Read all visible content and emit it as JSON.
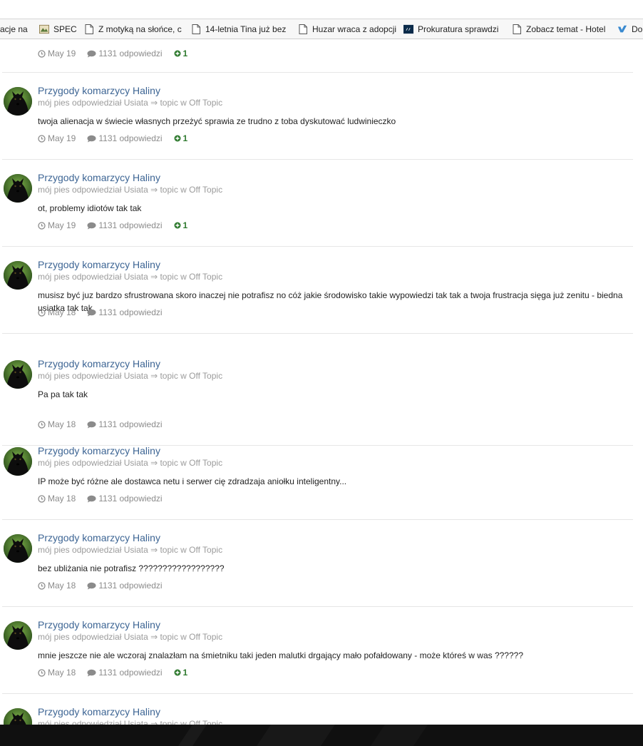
{
  "bookmarks": [
    {
      "label": "acje na",
      "icon": "page-icon"
    },
    {
      "label": "SPEC",
      "icon": "spec-favicon"
    },
    {
      "label": "Z motyką na słońce, c",
      "icon": "page-icon"
    },
    {
      "label": "14-letnia Tina już bez",
      "icon": "page-icon"
    },
    {
      "label": "Huzar wraca z adopcji",
      "icon": "page-icon"
    },
    {
      "label": "Prokuratura sprawdzi",
      "icon": "news-favicon"
    },
    {
      "label": "Zobacz temat - Hotel",
      "icon": "page-icon"
    },
    {
      "label": "Do",
      "icon": "checkmark-favicon"
    }
  ],
  "top_stats": {
    "date": "May 19",
    "replies": "1131 odpowiedzi",
    "rep": "1"
  },
  "posts": [
    {
      "title": "Przygody komarzycy Haliny",
      "meta": "mój pies odpowiedział Usiata ⇒ topic w Off Topic",
      "body": "twoja alienacja w świecie własnych przeżyć sprawia ze trudno z toba dyskutować ludwinieczko",
      "date": "May 19",
      "replies": "1131 odpowiedzi",
      "rep": "1"
    },
    {
      "title": "Przygody komarzycy Haliny",
      "meta": "mój pies odpowiedział Usiata ⇒ topic w Off Topic",
      "body": "ot, problemy idiotów tak tak",
      "date": "May 19",
      "replies": "1131 odpowiedzi",
      "rep": "1"
    },
    {
      "title": "Przygody komarzycy Haliny",
      "meta": "mój pies odpowiedział Usiata ⇒ topic w Off Topic",
      "body": "musisz być juz bardzo sfrustrowana skoro inaczej nie potrafisz no cóż jakie środowisko takie wypowiedzi tak tak a twoja frustracja sięga już zenitu - biedna usiatka tak tak",
      "date": "May 18",
      "replies": "1131 odpowiedzi",
      "rep": ""
    },
    {
      "title": "Przygody komarzycy Haliny",
      "meta": "mój pies odpowiedział Usiata ⇒ topic w Off Topic",
      "body": "Pa pa tak tak",
      "date": "May 18",
      "replies": "1131 odpowiedzi",
      "rep": ""
    },
    {
      "title": "Przygody komarzycy Haliny",
      "meta": "mój pies odpowiedział Usiata ⇒ topic w Off Topic",
      "body": "IP może być różne ale dostawca netu i serwer cię zdradzaja aniołku inteligentny...",
      "date": "May 18",
      "replies": "1131 odpowiedzi",
      "rep": ""
    },
    {
      "title": "Przygody komarzycy Haliny",
      "meta": "mój pies odpowiedział Usiata ⇒ topic w Off Topic",
      "body": "bez ubliżania nie potrafisz ??????????????????",
      "date": "May 18",
      "replies": "1131 odpowiedzi",
      "rep": ""
    },
    {
      "title": "Przygody komarzycy Haliny",
      "meta": "mój pies odpowiedział Usiata ⇒ topic w Off Topic",
      "body": "mnie jeszcze nie ale wczoraj znalazłam na śmietniku taki jeden malutki drgający mało pofałdowany - może któreś w was ??????",
      "date": "May 18",
      "replies": "1131 odpowiedzi",
      "rep": "1"
    },
    {
      "title": "Przygody komarzycy Haliny",
      "meta": "mój pies odpowiedział Usiata ⇒ topic w Off Topic",
      "body": "",
      "date": "",
      "replies": "",
      "rep": ""
    }
  ],
  "colors": {
    "link": "#3d6594",
    "meta": "#9b9b9b",
    "rep": "#2f7a2f"
  }
}
